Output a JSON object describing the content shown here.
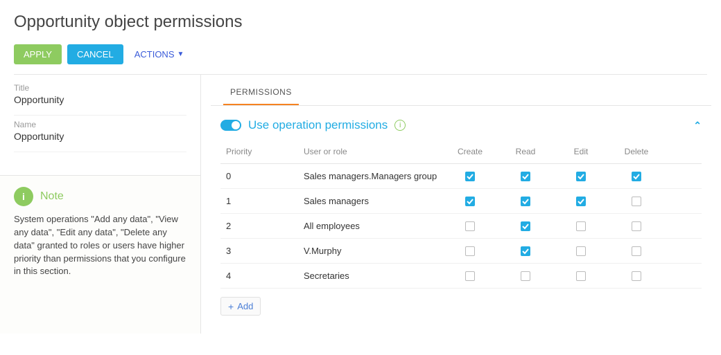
{
  "page_title": "Opportunity object permissions",
  "toolbar": {
    "apply": "APPLY",
    "cancel": "CANCEL",
    "actions": "ACTIONS"
  },
  "fields": {
    "title_label": "Title",
    "title_value": "Opportunity",
    "name_label": "Name",
    "name_value": "Opportunity"
  },
  "note": {
    "icon_glyph": "i",
    "label": "Note",
    "text": "System operations \"Add any data\", \"View any data\", \"Edit any data\", \"Delete any data\" granted to roles or users have higher priority than permissions that you configure in this section."
  },
  "tabs": {
    "permissions": "PERMISSIONS"
  },
  "section": {
    "title": "Use operation permissions",
    "toggle_on": true
  },
  "columns": {
    "priority": "Priority",
    "user": "User or role",
    "create": "Create",
    "read": "Read",
    "edit": "Edit",
    "delete": "Delete"
  },
  "rows": [
    {
      "priority": "0",
      "user": "Sales managers.Managers group",
      "create": true,
      "read": true,
      "edit": true,
      "delete": true
    },
    {
      "priority": "1",
      "user": "Sales managers",
      "create": true,
      "read": true,
      "edit": true,
      "delete": false
    },
    {
      "priority": "2",
      "user": "All employees",
      "create": false,
      "read": true,
      "edit": false,
      "delete": false
    },
    {
      "priority": "3",
      "user": "V.Murphy",
      "create": false,
      "read": true,
      "edit": false,
      "delete": false
    },
    {
      "priority": "4",
      "user": "Secretaries",
      "create": false,
      "read": false,
      "edit": false,
      "delete": false
    }
  ],
  "add_label": "Add"
}
